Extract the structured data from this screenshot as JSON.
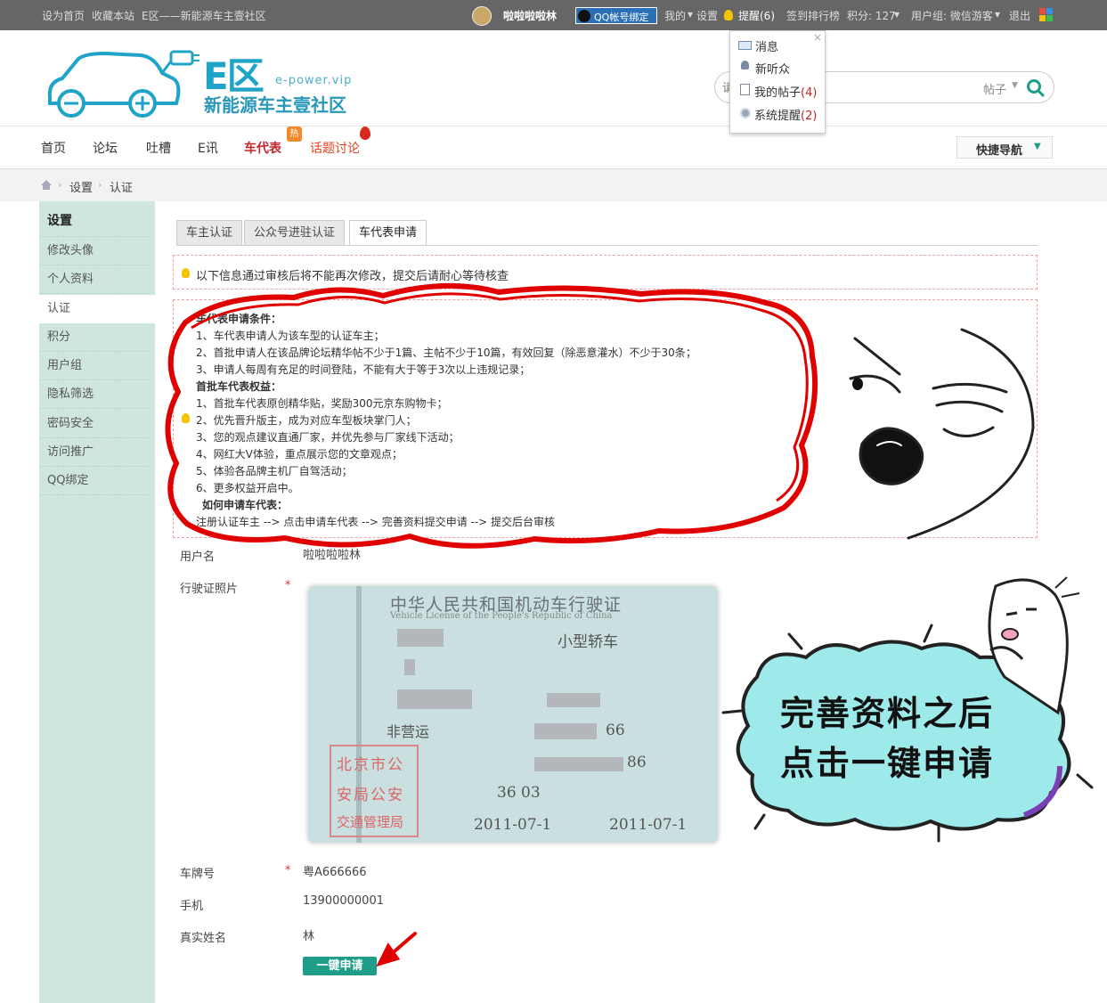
{
  "topbar": {
    "set_home": "设为首页",
    "bookmark": "收藏本站",
    "site_name": "E区——新能源车主壹社区",
    "username": "啦啦啦啦林",
    "qq_bind": "QQ帐号绑定",
    "my": "我的",
    "settings": "设置",
    "reminders": "提醒(6)",
    "checkin": "签到排行榜",
    "points": "积分: 127",
    "usergroup": "用户组: 微信游客",
    "logout": "退出"
  },
  "logo": {
    "brand": "E区",
    "domain": "e-power.vip",
    "slogan": "新能源车主壹社区"
  },
  "search": {
    "placeholder": "请",
    "scope": "帖子"
  },
  "dropdown": {
    "items": [
      "消息",
      "新听众",
      "我的帖子",
      "系统提醒"
    ],
    "my_posts_count": "(4)",
    "system_count": "(2)"
  },
  "nav": {
    "items": [
      "首页",
      "论坛",
      "吐槽",
      "E讯",
      "车代表",
      "话题讨论"
    ],
    "hot_badge": "热",
    "quick_nav": "快捷导航"
  },
  "breadcrumb": [
    "设置",
    "认证"
  ],
  "sidebar": {
    "title": "设置",
    "items": [
      "修改头像",
      "个人资料",
      "认证",
      "积分",
      "用户组",
      "隐私筛选",
      "密码安全",
      "访问推广",
      "QQ绑定"
    ]
  },
  "tabs": [
    "车主认证",
    "公众号进驻认证",
    "车代表申请"
  ],
  "notice": "以下信息通过审核后将不能再次修改，提交后请耐心等待核查",
  "conditions": {
    "title": "车代表申请条件：",
    "items": [
      "1、车代表申请人为该车型的认证车主；",
      "2、首批申请人在该品牌论坛精华帖不少于1篇、主帖不少于10篇，有效回复（除恶意灌水）不少于30条；",
      "3、申请人每周有充足的时间登陆，不能有大于等于3次以上违规记录；"
    ],
    "benefits_title": "首批车代表权益：",
    "benefits": [
      "1、首批车代表原创精华贴，奖励300元京东购物卡；",
      "2、优先晋升版主，成为对应车型板块掌门人；",
      "3、您的观点建议直通厂家，并优先参与厂家线下活动；",
      "4、网红大V体验，重点展示您的文章观点；",
      "5、体验各品牌主机厂自驾活动；",
      "6、更多权益开启中。"
    ],
    "howto_title": "如何申请车代表：",
    "howto": "注册认证车主 --> 点击申请车代表 --> 完善资料提交申请 --> 提交后台审核"
  },
  "form": {
    "username_label": "用户名",
    "username_value": "啦啦啦啦林",
    "license_label": "行驶证照片",
    "plate_label": "车牌号",
    "plate_value": "粤A666666",
    "phone_label": "手机",
    "phone_value": "13900000001",
    "realname_label": "真实姓名",
    "realname_value": "林",
    "submit": "一键申请"
  },
  "license_card": {
    "title": "中华人民共和国机动车行驶证",
    "subtitle": "Vehicle License of the People's Republic of China",
    "vehicle_type": "小型轿车",
    "use_character": "非营运",
    "model_frag": "66",
    "vin_frag": "86",
    "engine": "36 03",
    "date1": "2011-07-1",
    "date2": "2011-07-1",
    "seal": [
      "北京市公",
      "安局公安",
      "交通管理局"
    ]
  },
  "bubble": {
    "line1": "完善资料之后",
    "line2": "点击一键申请"
  },
  "colors": {
    "accent_green": "#1e9e88",
    "sidebar_bg": "#cfe6df",
    "annotation_red": "#e00000",
    "bubble_fill": "#9ee9ea",
    "topbar_bg": "#666666"
  }
}
